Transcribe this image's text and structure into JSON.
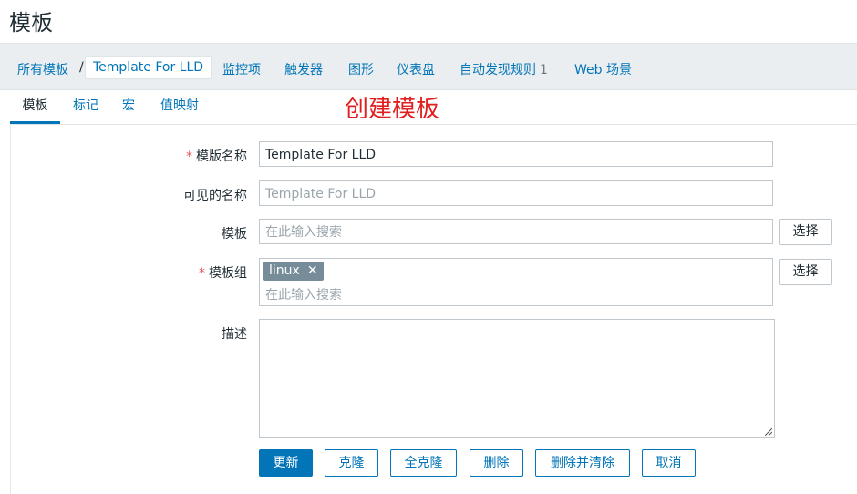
{
  "page": {
    "title": "模板"
  },
  "breadcrumb": {
    "all_templates": "所有模板",
    "separator": "/",
    "current": "Template For LLD",
    "items": [
      "监控项",
      "触发器",
      "图形",
      "仪表盘",
      "自动发现规则",
      "Web 场景"
    ],
    "lld_count": "1"
  },
  "tabs": [
    {
      "label": "模板",
      "active": true
    },
    {
      "label": "标记",
      "active": false
    },
    {
      "label": "宏",
      "active": false
    },
    {
      "label": "值映射",
      "active": false
    }
  ],
  "annotation": "创建模板",
  "form": {
    "required_mark": "*",
    "template_name": {
      "label": "模版名称",
      "value": "Template For LLD"
    },
    "visible_name": {
      "label": "可见的名称",
      "placeholder": "Template For LLD"
    },
    "templates": {
      "label": "模板",
      "placeholder": "在此输入搜索",
      "select_label": "选择"
    },
    "template_groups": {
      "label": "模板组",
      "chip": "linux",
      "chip_remove": "✕",
      "placeholder": "在此输入搜索",
      "select_label": "选择"
    },
    "description": {
      "label": "描述",
      "value": ""
    }
  },
  "actions": {
    "update": "更新",
    "clone": "克隆",
    "full_clone": "全克隆",
    "delete": "删除",
    "delete_and_clear": "删除并清除",
    "cancel": "取消"
  },
  "colors": {
    "link": "#0275b8",
    "required": "#e45959",
    "annotation": "#e02020",
    "chip": "#768d99"
  }
}
